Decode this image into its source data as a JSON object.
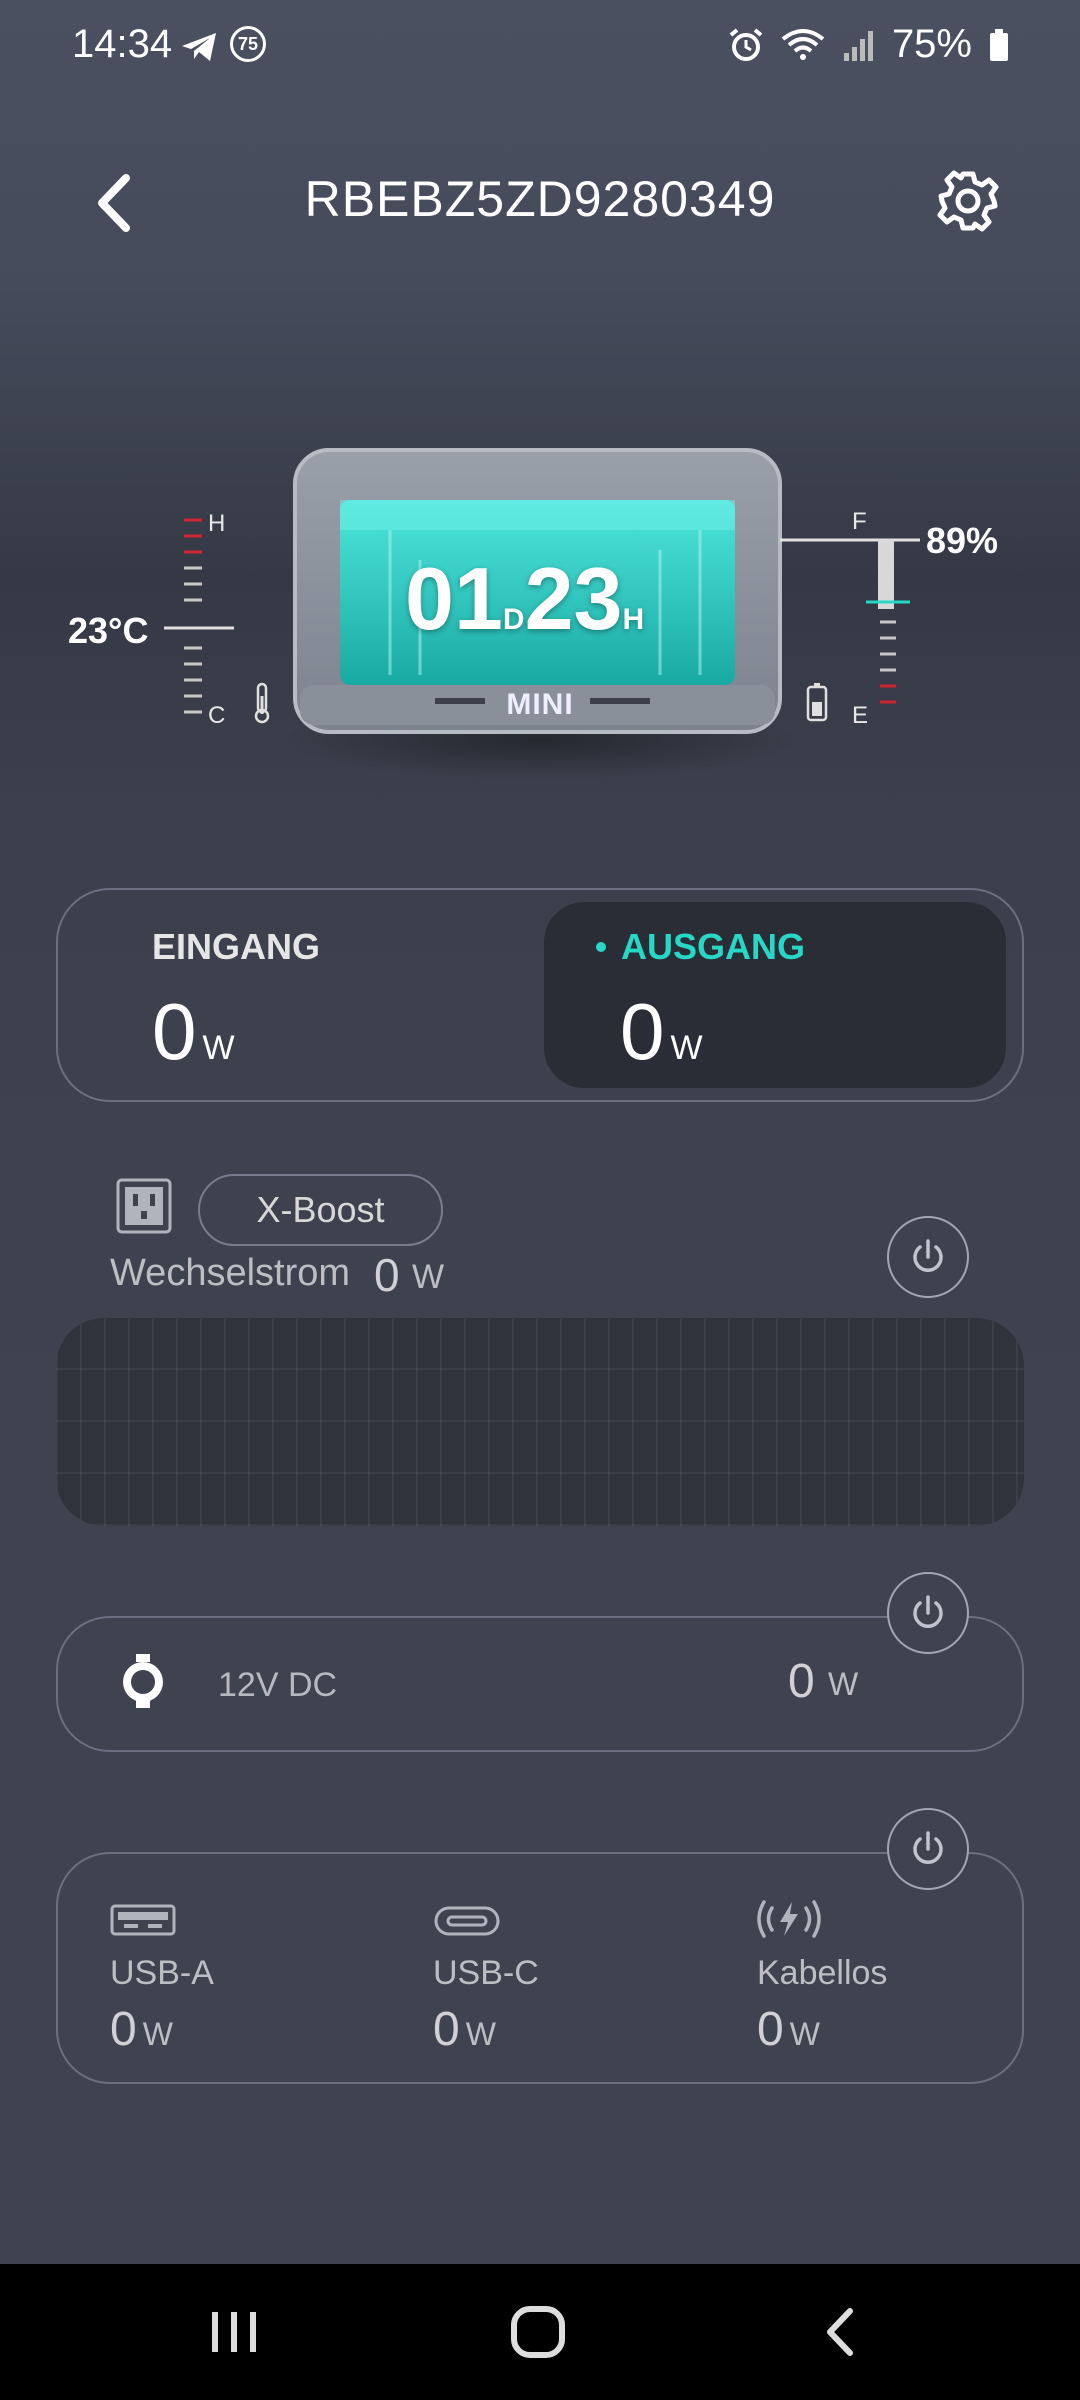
{
  "status_bar": {
    "time": "14:34",
    "notification_badge": "75",
    "battery_percent": "75%",
    "icons": [
      "telegram-icon",
      "notification-count-icon",
      "alarm-icon",
      "wifi-icon",
      "signal-icon",
      "battery-icon"
    ]
  },
  "header": {
    "title": "RBEBZ5ZD9280349",
    "back_icon": "chevron-left-icon",
    "settings_icon": "gear-icon"
  },
  "device": {
    "temperature": "23°C",
    "temp_high_label": "H",
    "temp_low_label": "C",
    "battery_level": "89%",
    "battery_full_label": "F",
    "battery_empty_label": "E",
    "runtime_days": "01",
    "runtime_days_unit": "D",
    "runtime_hours": "23",
    "runtime_hours_unit": "H",
    "model": "MINI",
    "battery_fraction": 0.89
  },
  "io": {
    "input_label": "EINGANG",
    "input_value": "0",
    "input_unit": "W",
    "output_label": "AUSGANG",
    "output_value": "0",
    "output_unit": "W",
    "output_active_color": "#27d8c6"
  },
  "ac": {
    "xboost_label": "X-Boost",
    "label": "Wechselstrom",
    "value": "0",
    "unit": "W"
  },
  "dc": {
    "label": "12V DC",
    "value": "0",
    "unit": "W"
  },
  "usb": {
    "ports": [
      {
        "label": "USB-A",
        "value": "0",
        "unit": "W",
        "icon": "usb-a-icon"
      },
      {
        "label": "USB-C",
        "value": "0",
        "unit": "W",
        "icon": "usb-c-icon"
      },
      {
        "label": "Kabellos",
        "value": "0",
        "unit": "W",
        "icon": "wireless-charging-icon"
      }
    ]
  },
  "colors": {
    "accent": "#27d8c6",
    "gauge_red": "#d0262b",
    "background": "#3f4350"
  }
}
